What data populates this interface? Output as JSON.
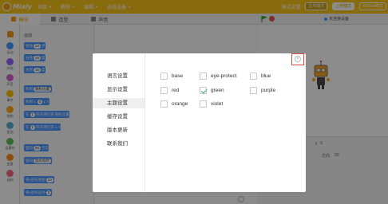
{
  "app": {
    "logo_text": "Mixly"
  },
  "topbar": {
    "menus": [
      "项目",
      "教程",
      "编辑",
      "选择设备"
    ],
    "right_items": [
      "模式设置",
      "在线模式",
      "上传模式",
      "Python模式"
    ]
  },
  "tabs": [
    {
      "label": "模块",
      "active": true
    },
    {
      "label": "造型",
      "active": false
    },
    {
      "label": "声音",
      "active": false
    }
  ],
  "stage_bar": {
    "connect_label": "未连接设备"
  },
  "palette": {
    "categories": [
      {
        "label": "运动",
        "color": "#4c97ff"
      },
      {
        "label": "外观",
        "color": "#9966ff"
      },
      {
        "label": "声音",
        "color": "#cf63cf"
      },
      {
        "label": "事件",
        "color": "#ffbf00"
      },
      {
        "label": "控制",
        "color": "#ffab19"
      },
      {
        "label": "侦测",
        "color": "#5cb1d6"
      },
      {
        "label": "运算符",
        "color": "#59c059"
      },
      {
        "label": "变量",
        "color": "#ff8c1a"
      },
      {
        "label": "自制",
        "color": "#ff6680"
      }
    ],
    "section_title": "运动",
    "blocks": [
      {
        "pre": "移动",
        "num": "10",
        "post": "步"
      },
      {
        "pre": "右转",
        "num": "15",
        "post": "度"
      },
      {
        "pre": "左转",
        "num": "15",
        "post": "度"
      },
      {
        "pre": "移到",
        "num": "随机位置",
        "post": ""
      },
      {
        "pre": "移到 x:",
        "num": "0",
        "post": "y: 0"
      },
      {
        "pre": "在",
        "num": "1",
        "post": "秒内滑行到 随机位置"
      },
      {
        "pre": "在",
        "num": "1",
        "post": "秒内滑行到 x: 0"
      },
      {
        "pre": "面向",
        "num": "90",
        "post": "方向"
      },
      {
        "pre": "面向",
        "num": "鼠标指针",
        "post": ""
      },
      {
        "pre": "将x坐标增加",
        "num": "10",
        "post": ""
      },
      {
        "pre": "将x坐标设为",
        "num": "0",
        "post": ""
      }
    ]
  },
  "sprite_panel": {
    "x_label": "x",
    "x_value": "0",
    "y_label": "y",
    "y_value": "0",
    "dir_label": "方向",
    "dir_value": "90",
    "size_value": "100"
  },
  "settings_dialog": {
    "nav_items": [
      {
        "label": "语言设置",
        "active": false
      },
      {
        "label": "显示设置",
        "active": false
      },
      {
        "label": "主题设置",
        "active": true
      },
      {
        "label": "缓存设置",
        "active": false
      },
      {
        "label": "版本更新",
        "active": false
      },
      {
        "label": "联系我们",
        "active": false
      }
    ],
    "themes": [
      {
        "label": "base",
        "checked": false
      },
      {
        "label": "eye-protect",
        "checked": false
      },
      {
        "label": "blue",
        "checked": false
      },
      {
        "label": "red",
        "checked": false
      },
      {
        "label": "green",
        "checked": true
      },
      {
        "label": "purple",
        "checked": false
      },
      {
        "label": "orange",
        "checked": false
      },
      {
        "label": "violet",
        "checked": false
      }
    ],
    "close_icon": "close-circle-icon",
    "highlight_color": "#e04a3f",
    "check_color": "#3aa55a"
  }
}
